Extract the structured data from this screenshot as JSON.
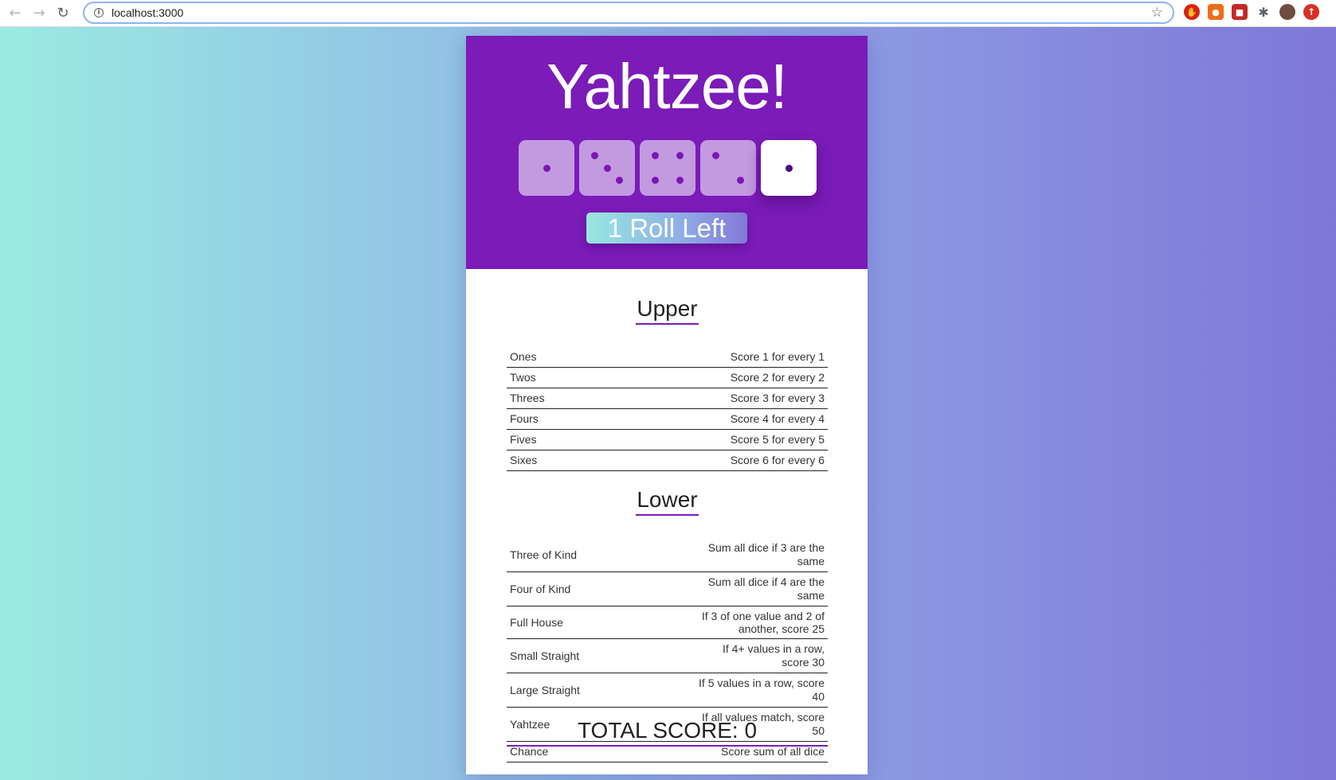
{
  "browser": {
    "url": "localhost:3000"
  },
  "game": {
    "title": "Yahtzee!",
    "dice": [
      1,
      3,
      4,
      2,
      1
    ],
    "locked": [
      false,
      false,
      false,
      false,
      true
    ],
    "roll_button_label": "1 Roll Left"
  },
  "upper": {
    "title": "Upper",
    "rows": [
      {
        "name": "Ones",
        "desc": "Score 1 for every 1"
      },
      {
        "name": "Twos",
        "desc": "Score 2 for every 2"
      },
      {
        "name": "Threes",
        "desc": "Score 3 for every 3"
      },
      {
        "name": "Fours",
        "desc": "Score 4 for every 4"
      },
      {
        "name": "Fives",
        "desc": "Score 5 for every 5"
      },
      {
        "name": "Sixes",
        "desc": "Score 6 for every 6"
      }
    ]
  },
  "lower": {
    "title": "Lower",
    "rows": [
      {
        "name": "Three of Kind",
        "desc": "Sum all dice if 3 are the same"
      },
      {
        "name": "Four of Kind",
        "desc": "Sum all dice if 4 are the same"
      },
      {
        "name": "Full House",
        "desc": "If 3 of one value and 2 of another, score 25"
      },
      {
        "name": "Small Straight",
        "desc": "If 4+ values in a row, score 30"
      },
      {
        "name": "Large Straight",
        "desc": "If 5 values in a row, score 40"
      },
      {
        "name": "Yahtzee",
        "desc": "If all values match, score 50"
      },
      {
        "name": "Chance",
        "desc": "Score sum of all dice"
      }
    ]
  },
  "total_score": "TOTAL SCORE: 0",
  "colors": {
    "header": "#7b1bb8",
    "die": "#c39ae0",
    "pip": "#7a17b5",
    "accent_line": "#7b1bb8"
  }
}
